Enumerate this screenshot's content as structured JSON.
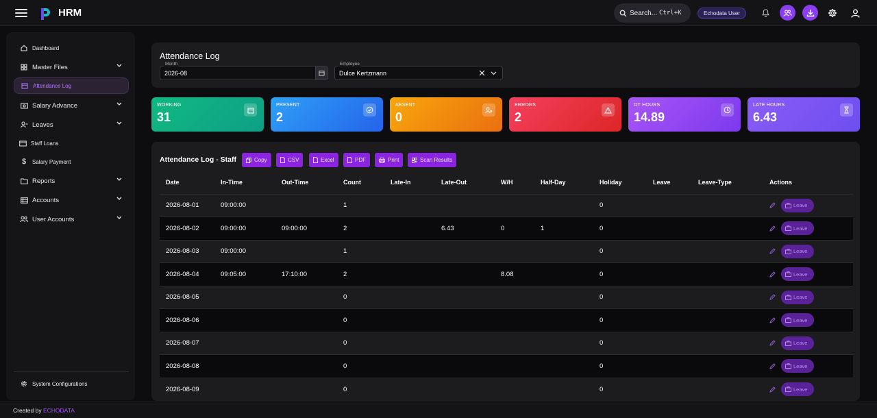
{
  "app": {
    "brand": "HRM"
  },
  "topbar": {
    "search_label": "Search...",
    "search_shortcut": "Ctrl+K",
    "user_badge": "Echodata User",
    "icons": [
      "bell-icon",
      "users-icon",
      "download-icon",
      "gear-icon",
      "user-icon"
    ]
  },
  "sidebar": {
    "items": [
      {
        "label": "Dashboard",
        "icon": "home-icon",
        "has_chevron": false
      },
      {
        "label": "Master Files",
        "icon": "grid-icon",
        "has_chevron": true
      },
      {
        "label": "Attendance Log",
        "icon": "calendar-icon",
        "has_chevron": false,
        "active": true
      },
      {
        "label": "Salary Advance",
        "icon": "cash-icon",
        "has_chevron": true
      },
      {
        "label": "Leaves",
        "icon": "user-minus-icon",
        "has_chevron": true
      },
      {
        "label": "Staff Loans",
        "icon": "card-icon",
        "has_chevron": false
      },
      {
        "label": "Salary Payment",
        "icon": "dollar-icon",
        "has_chevron": false
      },
      {
        "label": "Reports",
        "icon": "folder-icon",
        "has_chevron": true
      },
      {
        "label": "Accounts",
        "icon": "ledger-icon",
        "has_chevron": true
      },
      {
        "label": "User Accounts",
        "icon": "users-icon",
        "has_chevron": true
      }
    ],
    "system_config": "System Configurations"
  },
  "header": {
    "title": "Attendance Log",
    "month_label": "Month",
    "month_value": "2026-08",
    "employee_label": "Employee",
    "employee_value": "Dulce Kertzmann"
  },
  "stats": [
    {
      "label": "WORKING",
      "value": "31",
      "icon": "calendar-icon",
      "color": "#10b981"
    },
    {
      "label": "PRESENT",
      "value": "2",
      "icon": "check-circle-icon",
      "color": "#2d8cf0"
    },
    {
      "label": "ABSENT",
      "value": "0",
      "icon": "user-x-icon",
      "color": "#f59e0b"
    },
    {
      "label": "ERRORS",
      "value": "2",
      "icon": "warning-icon",
      "color": "#ef4456"
    },
    {
      "label": "OT HOURS",
      "value": "14.89",
      "icon": "clock-icon",
      "color": "#a855f7"
    },
    {
      "label": "LATE HOURS",
      "value": "6.43",
      "icon": "hourglass-icon",
      "color": "#8b5cf6"
    }
  ],
  "table": {
    "title": "Attendance Log - Staff",
    "tools": [
      "Copy",
      "CSV",
      "Excel",
      "PDF",
      "Print",
      "Scan Results"
    ],
    "columns": [
      "Date",
      "In-Time",
      "Out-Time",
      "Count",
      "Late-In",
      "Late-Out",
      "W/H",
      "Half-Day",
      "Holiday",
      "Leave",
      "Leave-Type",
      "Actions"
    ],
    "leave_btn": "Leave",
    "rows": [
      [
        "2026-08-01",
        "09:00:00",
        "",
        "1",
        "",
        "",
        "",
        "",
        "0",
        "",
        ""
      ],
      [
        "2026-08-02",
        "09:00:00",
        "09:00:00",
        "2",
        "",
        "6.43",
        "0",
        "1",
        "0",
        "",
        ""
      ],
      [
        "2026-08-03",
        "09:00:00",
        "",
        "1",
        "",
        "",
        "",
        "",
        "0",
        "",
        ""
      ],
      [
        "2026-08-04",
        "09:05:00",
        "17:10:00",
        "2",
        "",
        "",
        "8.08",
        "",
        "0",
        "",
        ""
      ],
      [
        "2026-08-05",
        "",
        "",
        "0",
        "",
        "",
        "",
        "",
        "0",
        "",
        ""
      ],
      [
        "2026-08-06",
        "",
        "",
        "0",
        "",
        "",
        "",
        "",
        "0",
        "",
        ""
      ],
      [
        "2026-08-07",
        "",
        "",
        "0",
        "",
        "",
        "",
        "",
        "0",
        "",
        ""
      ],
      [
        "2026-08-08",
        "",
        "",
        "0",
        "",
        "",
        "",
        "",
        "0",
        "",
        ""
      ],
      [
        "2026-08-09",
        "",
        "",
        "0",
        "",
        "",
        "",
        "",
        "0",
        "",
        ""
      ]
    ]
  },
  "footer": {
    "prefix": "Created by",
    "link": "ECHODATA"
  }
}
